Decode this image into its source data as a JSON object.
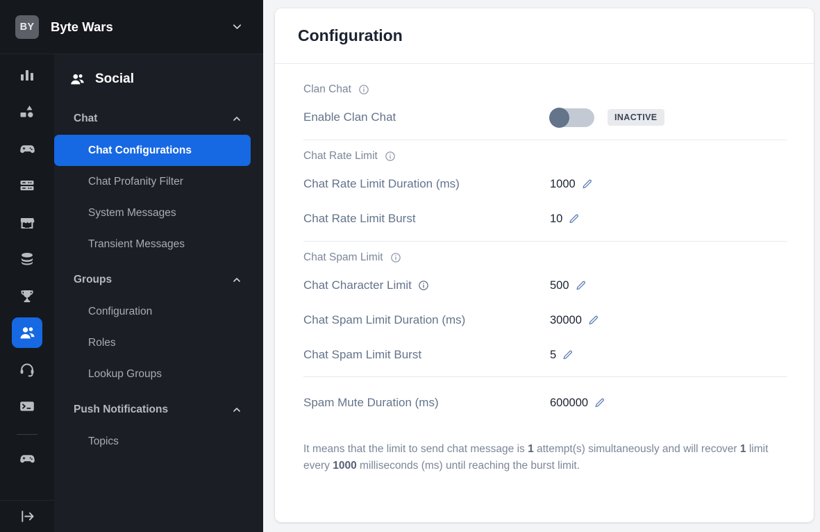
{
  "workspace": {
    "avatar_initials": "BY",
    "name": "Byte Wars",
    "chevron_icon": "chevron-down-icon"
  },
  "icon_rail": {
    "items": [
      {
        "name": "analytics-icon",
        "label": "Analytics"
      },
      {
        "name": "shapes-icon",
        "label": "Game Setup"
      },
      {
        "name": "gamepad-icon",
        "label": "Game Management"
      },
      {
        "name": "server-icon",
        "label": "Servers"
      },
      {
        "name": "storefront-icon",
        "label": "Store"
      },
      {
        "name": "database-icon",
        "label": "Storage"
      },
      {
        "name": "trophy-icon",
        "label": "Achievements"
      },
      {
        "name": "people-icon",
        "label": "Social",
        "active": true
      },
      {
        "name": "headset-icon",
        "label": "Support"
      },
      {
        "name": "terminal-icon",
        "label": "Console"
      }
    ],
    "footer_item": {
      "name": "logout-icon",
      "label": "Log Out"
    }
  },
  "sidebar": {
    "section_title": "Social",
    "section_icon": "people-icon",
    "groups": [
      {
        "label": "Chat",
        "caret_icon": "chevron-up-icon",
        "items": [
          {
            "label": "Chat Configurations",
            "active": true
          },
          {
            "label": "Chat Profanity Filter",
            "active": false
          },
          {
            "label": "System Messages",
            "active": false
          },
          {
            "label": "Transient Messages",
            "active": false
          }
        ]
      },
      {
        "label": "Groups",
        "caret_icon": "chevron-up-icon",
        "items": [
          {
            "label": "Configuration",
            "active": false
          },
          {
            "label": "Roles",
            "active": false
          },
          {
            "label": "Lookup Groups",
            "active": false
          }
        ]
      },
      {
        "label": "Push Notifications",
        "caret_icon": "chevron-up-icon",
        "items": [
          {
            "label": "Topics",
            "active": false
          }
        ]
      }
    ]
  },
  "main": {
    "title": "Configuration",
    "sections": {
      "clan_chat": {
        "label": "Clan Chat",
        "info_icon": "info-icon",
        "toggle_row": {
          "label": "Enable Clan Chat",
          "toggle_on": false,
          "status_badge": "INACTIVE"
        }
      },
      "chat_rate_limit": {
        "label": "Chat Rate Limit",
        "info_icon": "info-icon",
        "rows": [
          {
            "label": "Chat Rate Limit Duration (ms)",
            "value": "1000",
            "edit_icon": "pencil-icon",
            "has_info": false
          },
          {
            "label": "Chat Rate Limit Burst",
            "value": "10",
            "edit_icon": "pencil-icon",
            "has_info": false
          }
        ]
      },
      "chat_spam_limit": {
        "label": "Chat Spam Limit",
        "info_icon": "info-icon",
        "rows": [
          {
            "label": "Chat Character Limit",
            "value": "500",
            "edit_icon": "pencil-icon",
            "has_info": true
          },
          {
            "label": "Chat Spam Limit Duration (ms)",
            "value": "30000",
            "edit_icon": "pencil-icon",
            "has_info": false
          },
          {
            "label": "Chat Spam Limit Burst",
            "value": "5",
            "edit_icon": "pencil-icon",
            "has_info": false
          }
        ]
      },
      "spam_mute": {
        "rows": [
          {
            "label": "Spam Mute Duration (ms)",
            "value": "600000",
            "edit_icon": "pencil-icon",
            "has_info": false
          }
        ]
      }
    },
    "note": {
      "part1": "It means that the limit to send chat message is ",
      "bold1": "1",
      "part2": " attempt(s) simultaneously and will recover ",
      "bold2": "1",
      "part3": " limit every ",
      "bold3": "1000",
      "part4": " milliseconds (ms) until reaching the burst limit."
    }
  },
  "colors": {
    "accent_blue": "#1668e3",
    "panel_dark": "#15181d",
    "menu_dark": "#1b1e24",
    "page_bg": "#f3f4f6",
    "badge_bg": "#e8eaee",
    "toggle_knob": "#64748b"
  }
}
